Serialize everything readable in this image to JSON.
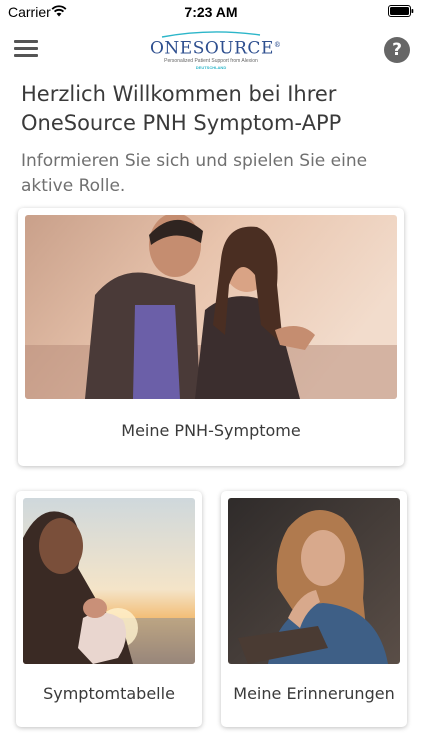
{
  "status_bar": {
    "carrier": "Carrier",
    "time": "7:23 AM"
  },
  "header": {
    "logo": {
      "name": "ONESOURCE",
      "registered": "®",
      "tagline": "Personalized Patient Support from Alexion",
      "country": "DEUTSCHLAND"
    },
    "help_symbol": "?"
  },
  "main": {
    "title": "Herzlich Willkommen bei Ihrer OneSource PNH Symptom-APP",
    "subtitle": "Informieren Sie sich und spielen Sie eine aktive Rolle.",
    "cards": [
      {
        "label": "Meine PNH-Symptome",
        "image": "couple-photo"
      },
      {
        "label": "Symptomtabelle",
        "image": "father-baby-sunset-photo"
      },
      {
        "label": "Meine Erinnerungen",
        "image": "woman-reading-photo"
      }
    ]
  },
  "colors": {
    "brand_blue": "#2e4f8f",
    "brand_teal": "#2cb6c9",
    "icon_gray": "#666666",
    "text_dark": "#3a3a3a",
    "text_gray": "#707070"
  }
}
